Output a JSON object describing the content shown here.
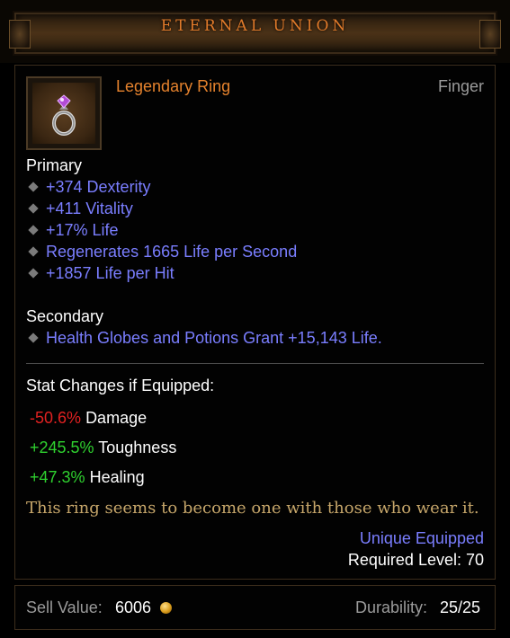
{
  "item": {
    "name": "ETERNAL UNION",
    "type": "Legendary Ring",
    "slot": "Finger",
    "icon": "ring-icon",
    "name_color": "#e07a2a",
    "type_color": "#e5822d"
  },
  "primary": {
    "label": "Primary",
    "affixes": [
      "+374 Dexterity",
      "+411 Vitality",
      "+17% Life",
      "Regenerates 1665 Life per Second",
      "+1857 Life per Hit"
    ]
  },
  "secondary": {
    "label": "Secondary",
    "affixes": [
      "Health Globes and Potions Grant +15,143 Life."
    ]
  },
  "stat_changes": {
    "heading": "Stat Changes if Equipped:",
    "rows": [
      {
        "value": "-50.6%",
        "label": "Damage",
        "color": "#e02121"
      },
      {
        "value": "+245.5%",
        "label": "Toughness",
        "color": "#2fd12f"
      },
      {
        "value": "+47.3%",
        "label": "Healing",
        "color": "#2fd12f"
      }
    ]
  },
  "flavor_text": "This ring seems to become one with those who wear it.",
  "unique_equipped": "Unique Equipped",
  "required_level": "Required Level: 70",
  "footer": {
    "sell_label": "Sell Value:",
    "sell_value": "6006",
    "currency_icon": "gold-coin-icon",
    "durability_label": "Durability:",
    "durability_value": "25/25"
  },
  "colors": {
    "affix": "#7a7eff",
    "flavor": "#c6a66a",
    "secondary_text": "#9b9b9b"
  }
}
